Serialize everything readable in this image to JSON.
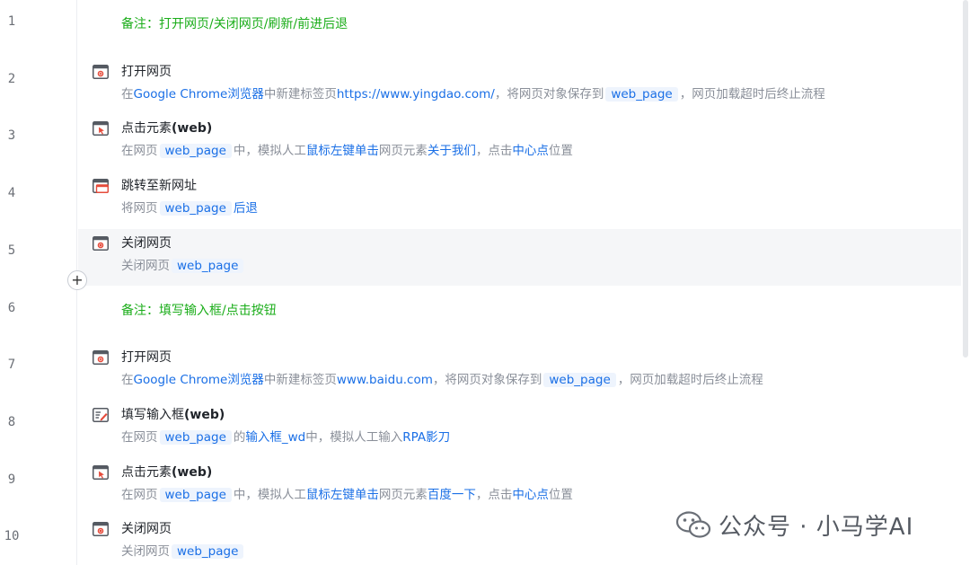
{
  "line_numbers": [
    "1",
    "2",
    "3",
    "4",
    "5",
    "6",
    "7",
    "8",
    "9",
    "10"
  ],
  "rows": [
    {
      "type": "comment",
      "text": "备注：打开网页/关闭网页/刷新/前进后退"
    },
    {
      "type": "step",
      "icon": "browser-open-icon",
      "title": "打开网页",
      "title_bold": "",
      "desc": [
        {
          "t": "在"
        },
        {
          "t": "Google Chrome浏览器",
          "c": "hl"
        },
        {
          "t": "中新建标签页"
        },
        {
          "t": "https://www.yingdao.com/",
          "c": "hl"
        },
        {
          "t": "，将网页对象保存到"
        },
        {
          "t": "web_page",
          "c": "var"
        },
        {
          "t": "，网页加载超时后终止流程"
        }
      ]
    },
    {
      "type": "step",
      "icon": "click-element-icon",
      "title": "点击元素",
      "title_bold": "(web)",
      "desc": [
        {
          "t": "在网页"
        },
        {
          "t": "web_page",
          "c": "var"
        },
        {
          "t": "中，模拟人工"
        },
        {
          "t": "鼠标左键单击",
          "c": "hl"
        },
        {
          "t": "网页元素"
        },
        {
          "t": "关于我们",
          "c": "hl"
        },
        {
          "t": "，点击"
        },
        {
          "t": "中心点",
          "c": "hl"
        },
        {
          "t": "位置"
        }
      ]
    },
    {
      "type": "step",
      "icon": "navigate-url-icon",
      "title": "跳转至新网址",
      "title_bold": "",
      "desc": [
        {
          "t": "将网页"
        },
        {
          "t": "web_page",
          "c": "var"
        },
        {
          "t": "后退",
          "c": "hl"
        }
      ]
    },
    {
      "type": "step",
      "icon": "browser-close-icon",
      "title": "关闭网页",
      "title_bold": "",
      "hover": true,
      "desc": [
        {
          "t": "关闭网页"
        },
        {
          "t": "web_page",
          "c": "var"
        }
      ]
    },
    {
      "type": "comment",
      "text": "备注：填写输入框/点击按钮"
    },
    {
      "type": "step",
      "icon": "browser-open-icon",
      "title": "打开网页",
      "title_bold": "",
      "desc": [
        {
          "t": "在"
        },
        {
          "t": "Google Chrome浏览器",
          "c": "hl"
        },
        {
          "t": "中新建标签页"
        },
        {
          "t": "www.baidu.com",
          "c": "hl"
        },
        {
          "t": "，将网页对象保存到"
        },
        {
          "t": "web_page",
          "c": "var"
        },
        {
          "t": "，网页加载超时后终止流程"
        }
      ]
    },
    {
      "type": "step",
      "icon": "fill-input-icon",
      "title": "填写输入框",
      "title_bold": "(web)",
      "desc": [
        {
          "t": "在网页"
        },
        {
          "t": "web_page",
          "c": "var"
        },
        {
          "t": "的"
        },
        {
          "t": "输入框_wd",
          "c": "hl"
        },
        {
          "t": "中，模拟人工输入"
        },
        {
          "t": "RPA影刀",
          "c": "hl"
        }
      ]
    },
    {
      "type": "step",
      "icon": "click-element-icon",
      "title": "点击元素",
      "title_bold": "(web)",
      "desc": [
        {
          "t": "在网页"
        },
        {
          "t": "web_page",
          "c": "var"
        },
        {
          "t": "中，模拟人工"
        },
        {
          "t": "鼠标左键单击",
          "c": "hl"
        },
        {
          "t": "网页元素"
        },
        {
          "t": "百度一下",
          "c": "hl"
        },
        {
          "t": "，点击"
        },
        {
          "t": "中心点",
          "c": "hl"
        },
        {
          "t": "位置"
        }
      ]
    },
    {
      "type": "step",
      "icon": "browser-close-icon",
      "title": "关闭网页",
      "title_bold": "",
      "desc": [
        {
          "t": "关闭网页"
        },
        {
          "t": "web_page",
          "c": "var"
        }
      ]
    }
  ],
  "add_button": "+",
  "watermark": "公众号 · 小马学AI",
  "colors": {
    "comment": "#1aad19",
    "highlight": "#1a6fe6",
    "variable_bg": "#eef4fd",
    "muted": "#8a8f99",
    "hover_row": "#f5f6f8"
  }
}
